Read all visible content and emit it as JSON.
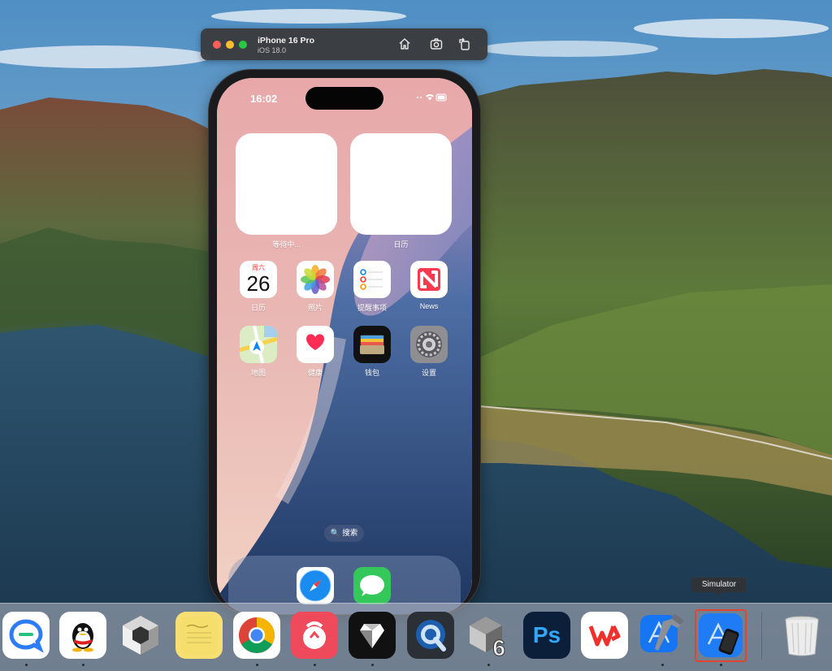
{
  "simulator": {
    "device_name": "iPhone 16 Pro",
    "os_version": "iOS 18.0",
    "buttons": [
      "home-icon",
      "screenshot-icon",
      "rotate-icon"
    ]
  },
  "iphone": {
    "status_time": "16:02",
    "widgets": [
      {
        "label": "等待中..."
      },
      {
        "label": "日历"
      }
    ],
    "apps": [
      {
        "label": "日历",
        "icon": "calendar-icon",
        "day_of_week": "周六",
        "date": "26"
      },
      {
        "label": "照片",
        "icon": "photos-icon"
      },
      {
        "label": "提醒事项",
        "icon": "reminders-icon"
      },
      {
        "label": "News",
        "icon": "news-icon"
      },
      {
        "label": "地图",
        "icon": "maps-icon"
      },
      {
        "label": "健康",
        "icon": "health-icon"
      },
      {
        "label": "钱包",
        "icon": "wallet-icon"
      },
      {
        "label": "设置",
        "icon": "settings-icon"
      }
    ],
    "search_label": "🔍 搜索",
    "dock_apps": [
      "safari-icon",
      "messages-icon"
    ]
  },
  "tooltip": "Simulator",
  "mac_dock": {
    "items": [
      {
        "name": "tencent-meeting-icon",
        "running": true
      },
      {
        "name": "qq-icon",
        "running": true
      },
      {
        "name": "unity-hub-icon",
        "running": false
      },
      {
        "name": "stickies-icon",
        "running": false
      },
      {
        "name": "chrome-icon",
        "running": true
      },
      {
        "name": "baidu-netdisk-icon",
        "running": true
      },
      {
        "name": "mirror-app-icon",
        "running": true
      },
      {
        "name": "quicktime-icon",
        "running": false
      },
      {
        "name": "unity-6-icon",
        "running": true
      },
      {
        "name": "photoshop-icon",
        "running": false
      },
      {
        "name": "wps-office-icon",
        "running": false
      },
      {
        "name": "xcode-icon",
        "running": true
      },
      {
        "name": "simulator-icon",
        "running": true
      },
      {
        "name": "trash-icon",
        "running": false
      }
    ],
    "ps_label": "Ps",
    "unity_version": "6"
  }
}
